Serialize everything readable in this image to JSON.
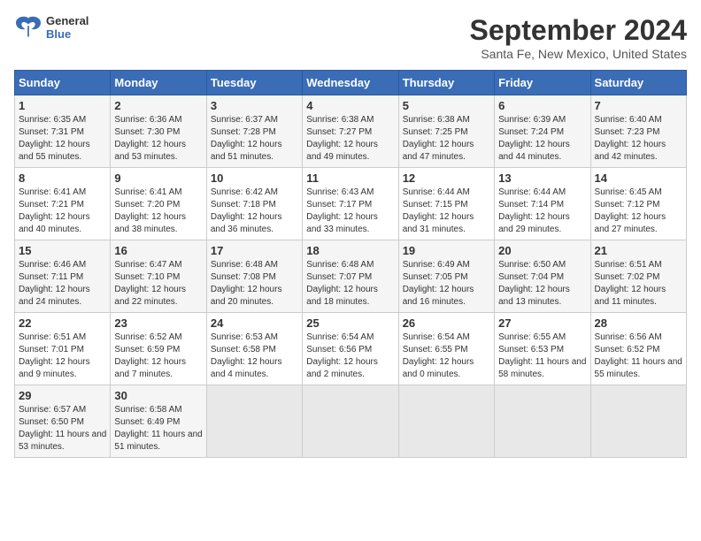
{
  "header": {
    "logo_line1": "General",
    "logo_line2": "Blue",
    "title": "September 2024",
    "subtitle": "Santa Fe, New Mexico, United States"
  },
  "calendar": {
    "days_of_week": [
      "Sunday",
      "Monday",
      "Tuesday",
      "Wednesday",
      "Thursday",
      "Friday",
      "Saturday"
    ],
    "weeks": [
      [
        null,
        {
          "day": 2,
          "sunrise": "6:36 AM",
          "sunset": "7:30 PM",
          "daylight": "12 hours and 53 minutes."
        },
        {
          "day": 3,
          "sunrise": "6:37 AM",
          "sunset": "7:28 PM",
          "daylight": "12 hours and 51 minutes."
        },
        {
          "day": 4,
          "sunrise": "6:38 AM",
          "sunset": "7:27 PM",
          "daylight": "12 hours and 49 minutes."
        },
        {
          "day": 5,
          "sunrise": "6:38 AM",
          "sunset": "7:25 PM",
          "daylight": "12 hours and 47 minutes."
        },
        {
          "day": 6,
          "sunrise": "6:39 AM",
          "sunset": "7:24 PM",
          "daylight": "12 hours and 44 minutes."
        },
        {
          "day": 7,
          "sunrise": "6:40 AM",
          "sunset": "7:23 PM",
          "daylight": "12 hours and 42 minutes."
        }
      ],
      [
        {
          "day": 1,
          "sunrise": "6:35 AM",
          "sunset": "7:31 PM",
          "daylight": "12 hours and 55 minutes."
        },
        null,
        null,
        null,
        null,
        null,
        null
      ],
      [
        {
          "day": 8,
          "sunrise": "6:41 AM",
          "sunset": "7:21 PM",
          "daylight": "12 hours and 40 minutes."
        },
        {
          "day": 9,
          "sunrise": "6:41 AM",
          "sunset": "7:20 PM",
          "daylight": "12 hours and 38 minutes."
        },
        {
          "day": 10,
          "sunrise": "6:42 AM",
          "sunset": "7:18 PM",
          "daylight": "12 hours and 36 minutes."
        },
        {
          "day": 11,
          "sunrise": "6:43 AM",
          "sunset": "7:17 PM",
          "daylight": "12 hours and 33 minutes."
        },
        {
          "day": 12,
          "sunrise": "6:44 AM",
          "sunset": "7:15 PM",
          "daylight": "12 hours and 31 minutes."
        },
        {
          "day": 13,
          "sunrise": "6:44 AM",
          "sunset": "7:14 PM",
          "daylight": "12 hours and 29 minutes."
        },
        {
          "day": 14,
          "sunrise": "6:45 AM",
          "sunset": "7:12 PM",
          "daylight": "12 hours and 27 minutes."
        }
      ],
      [
        {
          "day": 15,
          "sunrise": "6:46 AM",
          "sunset": "7:11 PM",
          "daylight": "12 hours and 24 minutes."
        },
        {
          "day": 16,
          "sunrise": "6:47 AM",
          "sunset": "7:10 PM",
          "daylight": "12 hours and 22 minutes."
        },
        {
          "day": 17,
          "sunrise": "6:48 AM",
          "sunset": "7:08 PM",
          "daylight": "12 hours and 20 minutes."
        },
        {
          "day": 18,
          "sunrise": "6:48 AM",
          "sunset": "7:07 PM",
          "daylight": "12 hours and 18 minutes."
        },
        {
          "day": 19,
          "sunrise": "6:49 AM",
          "sunset": "7:05 PM",
          "daylight": "12 hours and 16 minutes."
        },
        {
          "day": 20,
          "sunrise": "6:50 AM",
          "sunset": "7:04 PM",
          "daylight": "12 hours and 13 minutes."
        },
        {
          "day": 21,
          "sunrise": "6:51 AM",
          "sunset": "7:02 PM",
          "daylight": "12 hours and 11 minutes."
        }
      ],
      [
        {
          "day": 22,
          "sunrise": "6:51 AM",
          "sunset": "7:01 PM",
          "daylight": "12 hours and 9 minutes."
        },
        {
          "day": 23,
          "sunrise": "6:52 AM",
          "sunset": "6:59 PM",
          "daylight": "12 hours and 7 minutes."
        },
        {
          "day": 24,
          "sunrise": "6:53 AM",
          "sunset": "6:58 PM",
          "daylight": "12 hours and 4 minutes."
        },
        {
          "day": 25,
          "sunrise": "6:54 AM",
          "sunset": "6:56 PM",
          "daylight": "12 hours and 2 minutes."
        },
        {
          "day": 26,
          "sunrise": "6:54 AM",
          "sunset": "6:55 PM",
          "daylight": "12 hours and 0 minutes."
        },
        {
          "day": 27,
          "sunrise": "6:55 AM",
          "sunset": "6:53 PM",
          "daylight": "11 hours and 58 minutes."
        },
        {
          "day": 28,
          "sunrise": "6:56 AM",
          "sunset": "6:52 PM",
          "daylight": "11 hours and 55 minutes."
        }
      ],
      [
        {
          "day": 29,
          "sunrise": "6:57 AM",
          "sunset": "6:50 PM",
          "daylight": "11 hours and 53 minutes."
        },
        {
          "day": 30,
          "sunrise": "6:58 AM",
          "sunset": "6:49 PM",
          "daylight": "11 hours and 51 minutes."
        },
        null,
        null,
        null,
        null,
        null
      ]
    ]
  }
}
